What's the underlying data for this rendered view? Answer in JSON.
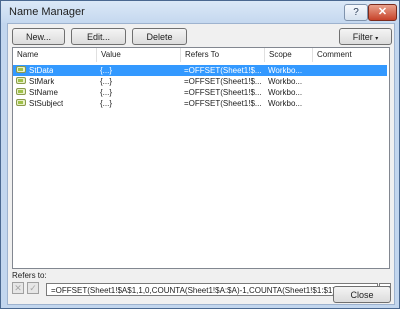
{
  "window": {
    "title": "Name Manager"
  },
  "titlebar": {
    "help_glyph": "?",
    "close_glyph": "✕"
  },
  "toolbar": {
    "new_label": "New...",
    "edit_label": "Edit...",
    "delete_label": "Delete",
    "filter_label": "Filter"
  },
  "columns": [
    "Name",
    "Value",
    "Refers To",
    "Scope",
    "Comment"
  ],
  "rows": [
    {
      "name": "StData",
      "value": "{...}",
      "refers_to": "=OFFSET(Sheet1!$...",
      "scope": "Workbo...",
      "comment": ""
    },
    {
      "name": "StMark",
      "value": "{...}",
      "refers_to": "=OFFSET(Sheet1!$...",
      "scope": "Workbo...",
      "comment": ""
    },
    {
      "name": "StName",
      "value": "{...}",
      "refers_to": "=OFFSET(Sheet1!$...",
      "scope": "Workbo...",
      "comment": ""
    },
    {
      "name": "StSubject",
      "value": "{...}",
      "refers_to": "=OFFSET(Sheet1!$...",
      "scope": "Workbo...",
      "comment": ""
    }
  ],
  "selected_row": 0,
  "refers_to": {
    "label": "Refers to:",
    "formula": "=OFFSET(Sheet1!$A$1,1,0,COUNTA(Sheet1!$A:$A)-1,COUNTA(Sheet1!$1:$1))"
  },
  "footer": {
    "close_label": "Close"
  }
}
